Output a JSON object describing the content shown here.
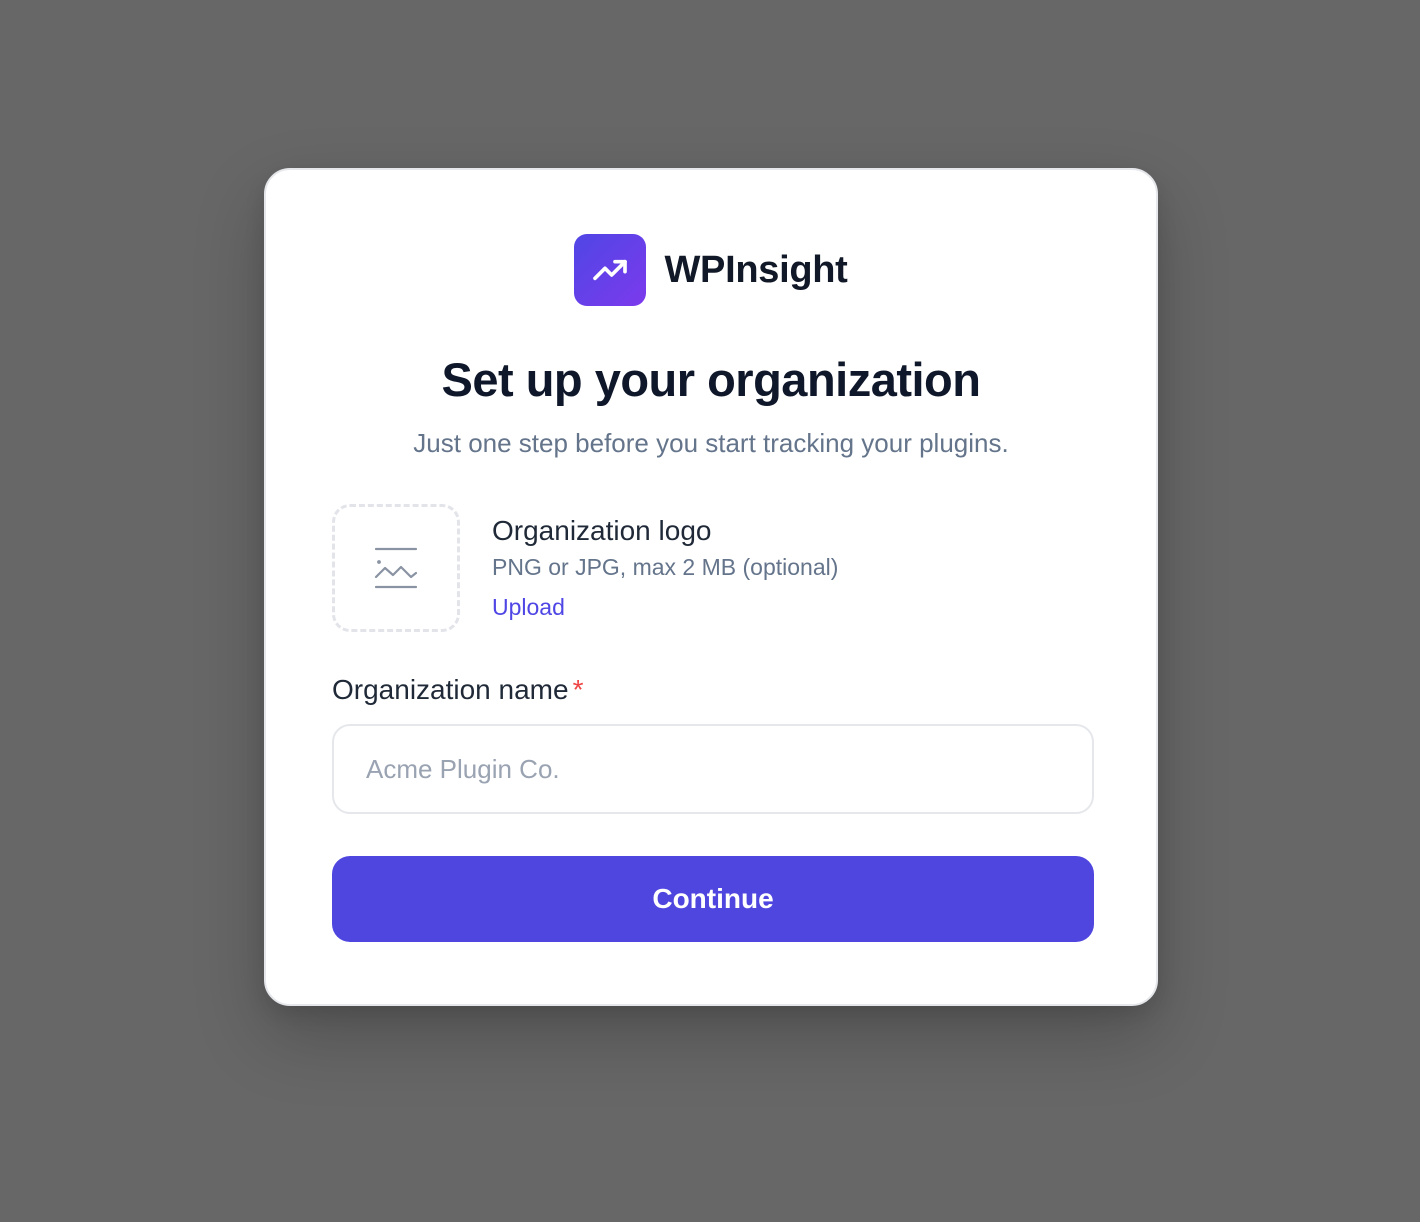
{
  "brand": {
    "name": "WPInsight",
    "icon": "trending-up-icon",
    "gradient": [
      "#4f46e5",
      "#7c3aed"
    ]
  },
  "header": {
    "title": "Set up your organization",
    "subtitle": "Just one step before you start tracking your plugins."
  },
  "logo_upload": {
    "icon": "image-placeholder-icon",
    "title": "Organization logo",
    "hint": "PNG or JPG, max 2 MB (optional)",
    "upload_label": "Upload"
  },
  "org_name": {
    "label": "Organization name",
    "required_marker": "*",
    "placeholder": "Acme Plugin Co.",
    "value": ""
  },
  "actions": {
    "continue_label": "Continue"
  },
  "colors": {
    "primary": "#4f46df",
    "link": "#4f46e5",
    "required": "#ef4444",
    "backdrop": "#676767"
  }
}
